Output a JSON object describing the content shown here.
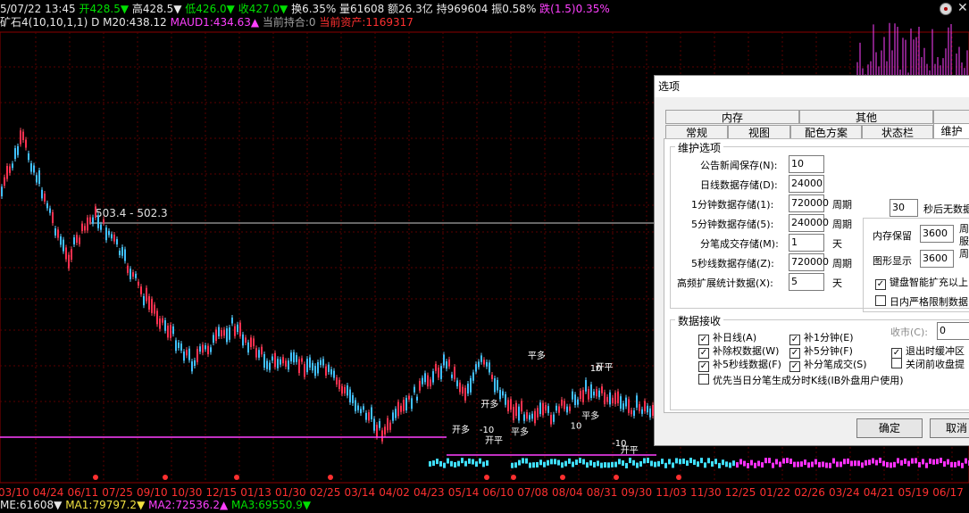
{
  "header": {
    "row1": [
      {
        "text": "5/07/22 13:45 ",
        "cls": "c-white"
      },
      {
        "text": "开428.5▼",
        "cls": "c-green"
      },
      {
        "text": " 高428.5▼",
        "cls": "c-white"
      },
      {
        "text": " 低426.0▼",
        "cls": "c-green"
      },
      {
        "text": " 收427.0▼",
        "cls": "c-green"
      },
      {
        "text": " 换6.35%",
        "cls": "c-white"
      },
      {
        "text": " 量61608",
        "cls": "c-white"
      },
      {
        "text": " 额26.3亿",
        "cls": "c-white"
      },
      {
        "text": " 持969604",
        "cls": "c-white"
      },
      {
        "text": " 振0.58%",
        "cls": "c-white"
      },
      {
        "text": " 跌(1.5)0.35%",
        "cls": "c-mag"
      }
    ],
    "row2": [
      {
        "text": "矿石4(10,10,1,1) D ",
        "cls": "c-white"
      },
      {
        "text": "M20:438.12",
        "cls": "c-white"
      },
      {
        "text": "  MAUD1:434.63▲",
        "cls": "c-mag"
      },
      {
        "text": " 当前持合:0",
        "cls": "c-gray"
      },
      {
        "text": "  当前资产:1169317",
        "cls": "c-red2"
      }
    ]
  },
  "price_tag": "503.4 - 502.3",
  "x_axis": [
    "03/10",
    "04/24",
    "06/11",
    "07/25",
    "09/10",
    "10/30",
    "12/15",
    "01/13",
    "01/30",
    "02/25",
    "03/14",
    "04/02",
    "04/23",
    "05/14",
    "06/10",
    "07/08",
    "08/04",
    "08/31",
    "09/30",
    "11/03",
    "11/30",
    "12/25",
    "01/22",
    "02/26",
    "03/24",
    "04/21",
    "05/19",
    "06/17"
  ],
  "footer": [
    {
      "text": "ME:61608▼",
      "cls": "c-white"
    },
    {
      "text": "  MA1:79797.2▼",
      "cls": "c-yellow"
    },
    {
      "text": "  MA2:72536.2▲",
      "cls": "c-mag"
    },
    {
      "text": "  MA3:69550.9▼",
      "cls": "c-green"
    }
  ],
  "dialog": {
    "title": "选项",
    "tabs_row1": [
      "内存",
      "其他"
    ],
    "tabs_row2": [
      "常规",
      "视图",
      "配色方案",
      "状态栏",
      "维护"
    ],
    "maintain": {
      "group_title": "维护选项",
      "fields": [
        {
          "label": "公告新闻保存(N):",
          "value": "10",
          "unit": ""
        },
        {
          "label": "日线数据存储(D):",
          "value": "24000",
          "unit": ""
        },
        {
          "label": "1分钟数据存储(1):",
          "value": "720000",
          "unit": "周期"
        },
        {
          "label": "5分钟数据存储(5):",
          "value": "240000",
          "unit": "周期"
        },
        {
          "label": "分笔成交存储(M):",
          "value": "1",
          "unit": "天"
        },
        {
          "label": "5秒线数据存储(Z):",
          "value": "720000",
          "unit": "周期"
        },
        {
          "label": "高频扩展统计数据(X):",
          "value": "5",
          "unit": "天"
        }
      ],
      "sec_value": "30",
      "sec_label": "秒后无数据",
      "mem_label": "内存保留",
      "mem_value": "3600",
      "mem_unit": "周",
      "mem_unit2": "服",
      "graph_label": "图形显示",
      "graph_value": "3600",
      "graph_unit": "周",
      "chk_smart": "键盘智能扩充以上",
      "chk_strict": "日内严格限制数据"
    },
    "receive": {
      "group_title": "数据接收",
      "close_label": "收市(C):",
      "close_value": "0",
      "checks": [
        {
          "label": "补日线(A)",
          "checked": true
        },
        {
          "label": "补1分钟(E)",
          "checked": true
        },
        {
          "label": "退出时缓冲区",
          "checked": true
        },
        {
          "label": "补除权数据(W)",
          "checked": true
        },
        {
          "label": "补5分钟(F)",
          "checked": true
        },
        {
          "label": "补5秒线数据(F)",
          "checked": true
        },
        {
          "label": "补分笔成交(S)",
          "checked": true
        },
        {
          "label": "关闭前收盘提",
          "checked": false
        },
        {
          "label": "优先当日分笔生成分时K线(IB外盘用户使用)",
          "checked": false
        }
      ]
    },
    "ok": "确定",
    "cancel": "取消"
  }
}
